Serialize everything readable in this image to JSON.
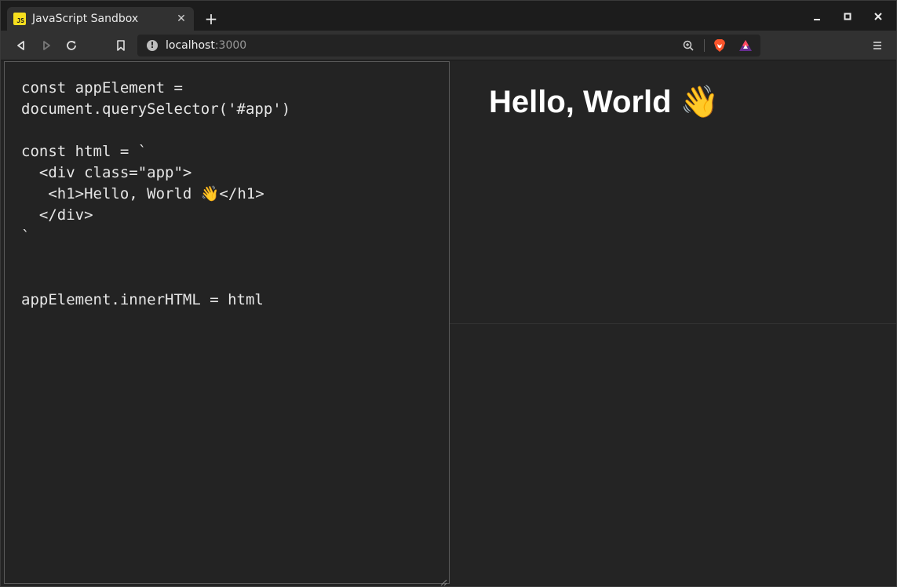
{
  "tab": {
    "favicon_text": "JS",
    "title": "JavaScript Sandbox",
    "close_glyph": "✕"
  },
  "new_tab_glyph": "+",
  "address": {
    "host": "localhost",
    "port": ":3000"
  },
  "editor": {
    "code": "const appElement =\ndocument.querySelector('#app')\n\nconst html = `\n  <div class=\"app\">\n   <h1>Hello, World 👋</h1>\n  </div>\n`\n\n\nappElement.innerHTML = html"
  },
  "preview": {
    "heading": "Hello, World 👋"
  },
  "icons": {
    "back": "back-arrow-icon",
    "forward": "forward-arrow-icon",
    "reload": "reload-icon",
    "bookmark": "bookmark-icon",
    "info": "info-icon",
    "zoom": "zoom-icon",
    "brave": "brave-shields-icon",
    "rewards": "brave-rewards-icon",
    "menu": "hamburger-menu-icon"
  },
  "colors": {
    "favicon_bg": "#f7df1e",
    "brave_orange": "#fb542b",
    "rewards_purple": "#662d91"
  }
}
